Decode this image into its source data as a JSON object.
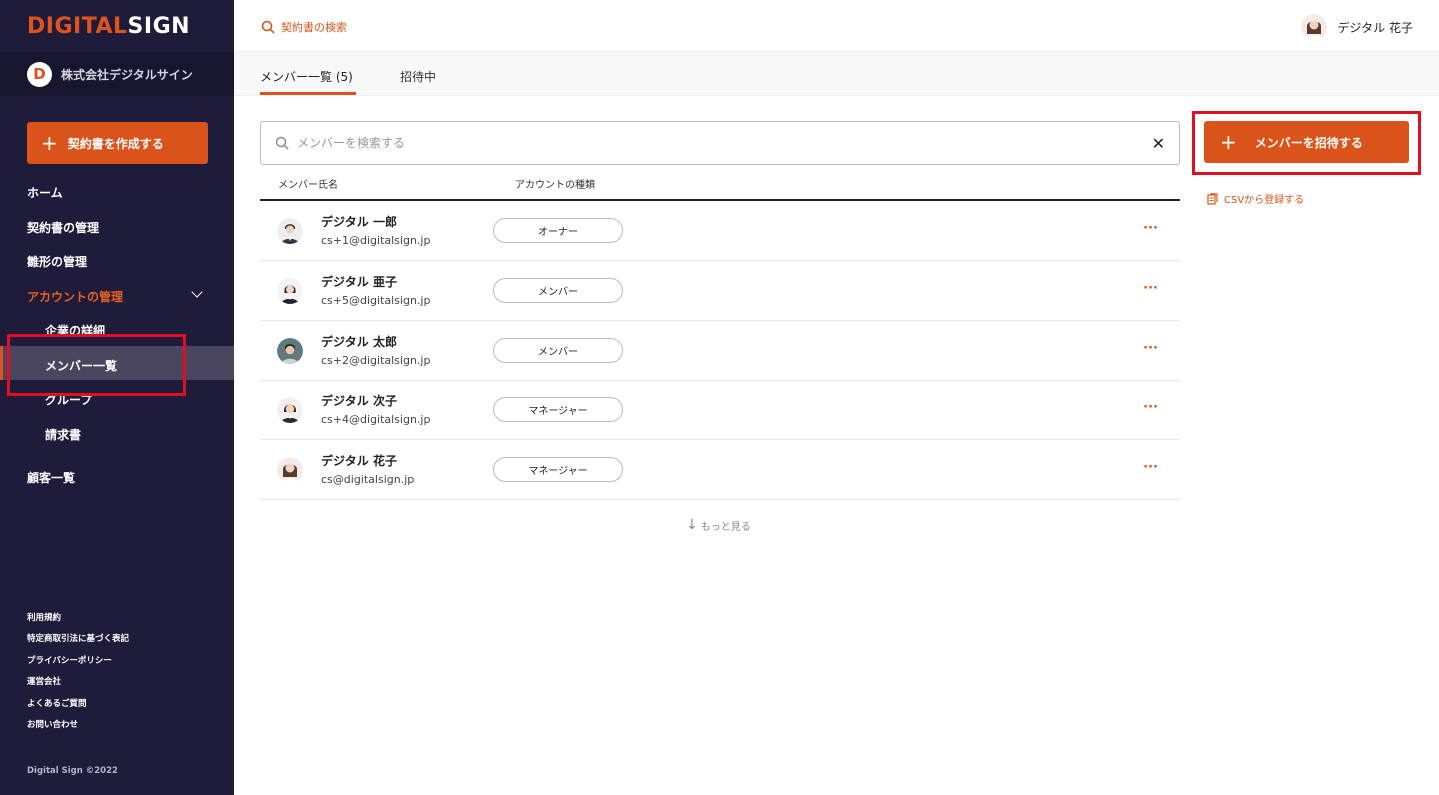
{
  "logo": {
    "accent": "DIGITAL",
    "rest": "SIGN"
  },
  "company": {
    "badge": "D",
    "name": "株式会社デジタルサイン"
  },
  "sidebar": {
    "create_button": "契約書を作成する",
    "items": [
      {
        "label": "ホーム"
      },
      {
        "label": "契約書の管理"
      },
      {
        "label": "雛形の管理"
      },
      {
        "label": "アカウントの管理"
      },
      {
        "label": "顧客一覧"
      }
    ],
    "sub_items": [
      {
        "label": "企業の詳細"
      },
      {
        "label": "メンバー一覧"
      },
      {
        "label": "グループ"
      },
      {
        "label": "請求書"
      }
    ],
    "footer_links": [
      {
        "label": "利用規約"
      },
      {
        "label": "特定商取引法に基づく表記"
      },
      {
        "label": "プライバシーポリシー"
      },
      {
        "label": "運営会社"
      },
      {
        "label": "よくあるご質問"
      },
      {
        "label": "お問い合わせ"
      }
    ],
    "copyright": "Digital Sign ©2022"
  },
  "topbar": {
    "search_label": "契約書の検索",
    "user_name": "デジタル 花子"
  },
  "tabs": [
    {
      "label": "メンバー一覧 (5)"
    },
    {
      "label": "招待中"
    }
  ],
  "member_search": {
    "placeholder": "メンバーを検索する"
  },
  "invite_button": "メンバーを招待する",
  "csv_link": "CSVから登録する",
  "table": {
    "headers": [
      "メンバー氏名",
      "アカウントの種類"
    ],
    "rows": [
      {
        "name": "デジタル 一郎",
        "email": "cs+1@digitalsign.jp",
        "role": "オーナー"
      },
      {
        "name": "デジタル 亜子",
        "email": "cs+5@digitalsign.jp",
        "role": "メンバー"
      },
      {
        "name": "デジタル 太郎",
        "email": "cs+2@digitalsign.jp",
        "role": "メンバー"
      },
      {
        "name": "デジタル 次子",
        "email": "cs+4@digitalsign.jp",
        "role": "マネージャー"
      },
      {
        "name": "デジタル 花子",
        "email": "cs@digitalsign.jp",
        "role": "マネージャー"
      }
    ],
    "more_icon": "···",
    "show_more": "もっと見る"
  },
  "colors": {
    "accent": "#d9531a",
    "sidebar_bg": "#1f1b3a",
    "highlight": "#e0101e"
  }
}
